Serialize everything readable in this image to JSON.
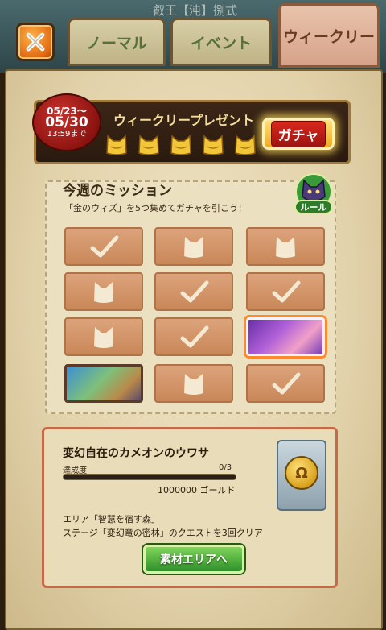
{
  "header": {
    "top_title": "叡王【沌】捌式"
  },
  "tabs": [
    {
      "label": "ノーマル"
    },
    {
      "label": "イベント"
    },
    {
      "label": "ウィークリー"
    }
  ],
  "present": {
    "date_start": "05/23〜",
    "date_end": "05/30",
    "time_end": "13:59まで",
    "title": "ウィークリープレゼント",
    "gacha_label": "ガチャ",
    "cat_count": 5
  },
  "mission": {
    "title": "今週のミッション",
    "subtitle": "「金のウィズ」を5つ集めてガチャを引こう！",
    "rule_label": "ルール",
    "tiles": [
      {
        "state": "done"
      },
      {
        "state": "cat"
      },
      {
        "state": "cat"
      },
      {
        "state": "cat"
      },
      {
        "state": "done"
      },
      {
        "state": "done"
      },
      {
        "state": "cat"
      },
      {
        "state": "done"
      },
      {
        "state": "image-selected"
      },
      {
        "state": "image"
      },
      {
        "state": "cat"
      },
      {
        "state": "done"
      }
    ]
  },
  "quest": {
    "title": "変幻自在のカメオンのウワサ",
    "progress_label": "達成度",
    "progress_count": "0/3",
    "progress_fraction": 0,
    "reward": "1000000 ゴールド",
    "desc_line1": "エリア「智慧を宿す森」",
    "desc_line2": "ステージ「変幻竜の密林」のクエストを3回クリア",
    "button_label": "素材エリアへ"
  },
  "colors": {
    "accent_gold": "#f0a820",
    "accent_red": "#c8312b",
    "accent_green": "#2f8f2a"
  }
}
